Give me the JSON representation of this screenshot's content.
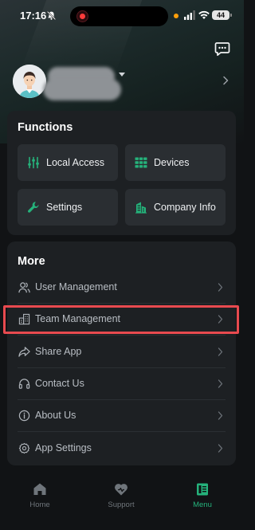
{
  "status_bar": {
    "time": "17:16",
    "battery": "44",
    "icons": [
      "bell-slash-icon",
      "recording-icon",
      "cellular-signal-icon",
      "wifi-icon",
      "battery-icon"
    ]
  },
  "header": {
    "message_icon": "chat-bubble-icon",
    "profile": {
      "avatar_icon": "user-avatar-icon",
      "dropdown_icon": "caret-down-icon",
      "chevron_icon": "chevron-right-icon"
    }
  },
  "functions": {
    "title": "Functions",
    "items": [
      {
        "label": "Local Access",
        "icon": "sliders-icon"
      },
      {
        "label": "Devices",
        "icon": "devices-grid-icon"
      },
      {
        "label": "Settings",
        "icon": "wrench-icon"
      },
      {
        "label": "Company Info",
        "icon": "building-icon"
      }
    ]
  },
  "more": {
    "title": "More",
    "items": [
      {
        "label": "User Management",
        "icon": "users-icon"
      },
      {
        "label": "Team Management",
        "icon": "office-building-icon",
        "highlighted": true
      },
      {
        "label": "Share App",
        "icon": "share-arrow-icon"
      },
      {
        "label": "Contact Us",
        "icon": "headset-icon"
      },
      {
        "label": "About Us",
        "icon": "info-circle-icon"
      },
      {
        "label": "App Settings",
        "icon": "cog-icon"
      }
    ]
  },
  "tabs": [
    {
      "label": "Home",
      "icon": "home-icon",
      "active": false
    },
    {
      "label": "Support",
      "icon": "heart-support-icon",
      "active": false
    },
    {
      "label": "Menu",
      "icon": "book-menu-icon",
      "active": true
    }
  ],
  "colors": {
    "accent": "#25b27b",
    "card_bg": "#1d2023",
    "button_bg": "#2a2e32",
    "highlight_border": "#e84a4f",
    "page_bg": "#111315"
  }
}
